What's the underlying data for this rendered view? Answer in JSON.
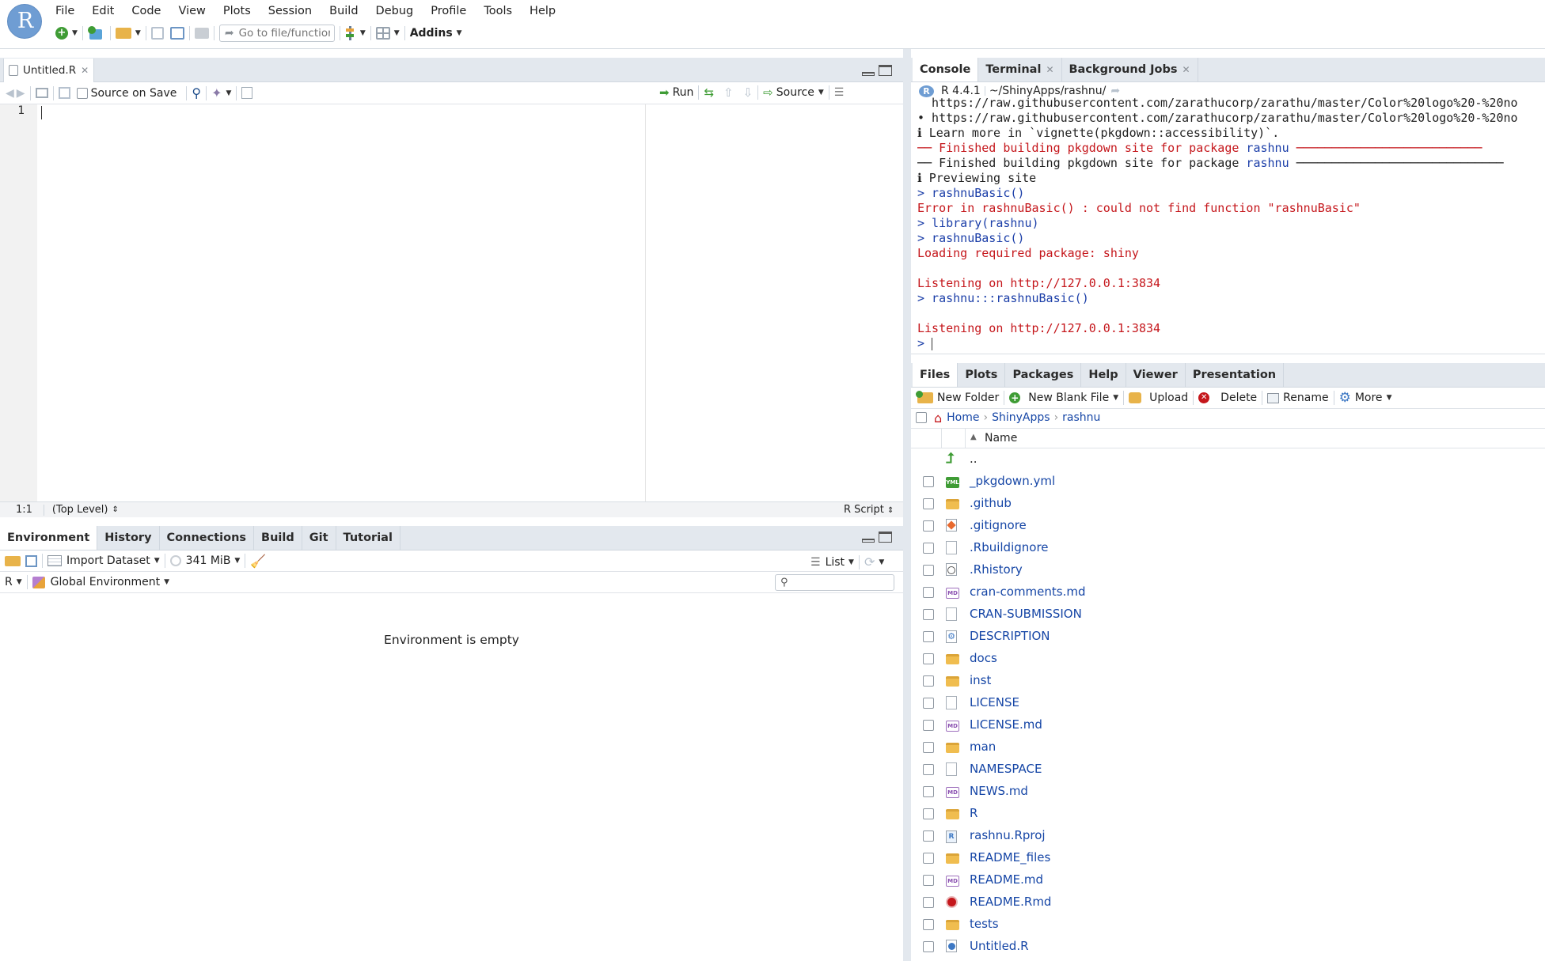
{
  "menu": [
    "File",
    "Edit",
    "Code",
    "View",
    "Plots",
    "Session",
    "Build",
    "Debug",
    "Profile",
    "Tools",
    "Help"
  ],
  "toolbar": {
    "goto_placeholder": "Go to file/function",
    "addins": "Addins"
  },
  "editor": {
    "tab_label": "Untitled.R",
    "source_on_save": "Source on Save",
    "run": "Run",
    "source": "Source",
    "line_number": "1",
    "status_pos": "1:1",
    "status_scope": "(Top Level)",
    "status_type": "R Script"
  },
  "env": {
    "tabs": [
      "Environment",
      "History",
      "Connections",
      "Build",
      "Git",
      "Tutorial"
    ],
    "import_dataset": "Import Dataset",
    "memory": "341 MiB",
    "list": "List",
    "lang": "R",
    "global_env": "Global Environment",
    "empty_msg": "Environment is empty"
  },
  "console": {
    "tabs": [
      "Console",
      "Terminal",
      "Background Jobs"
    ],
    "version": "R 4.4.1",
    "path": "~/ShinyApps/rashnu/",
    "lines": [
      {
        "t": "  https://raw.githubusercontent.com/zarathucorp/zarathu/master/Color%20logo%20-%20no",
        "c": "dk"
      },
      {
        "t": "• https://raw.githubusercontent.com/zarathucorp/zarathu/master/Color%20logo%20-%20no",
        "c": "dk"
      },
      {
        "t": "ℹ Learn more in `vignette(pkgdown::accessibility)`.",
        "c": "dk"
      },
      {
        "t": "── Finished building pkgdown site for package ",
        "c": "red",
        "b": "rashnu",
        "after": " ──────────────────────────",
        "ac": "red"
      },
      {
        "t": "── Finished building pkgdown site for package ",
        "c": "dk",
        "b": "rashnu",
        "after": " ─────────────────────────────",
        "ac": "dk"
      },
      {
        "t": "ℹ Previewing site",
        "c": "dk"
      },
      {
        "t": "> rashnuBasic()",
        "c": "blue"
      },
      {
        "t": "Error in rashnuBasic() : could not find function \"rashnuBasic\"",
        "c": "red"
      },
      {
        "t": "> library(rashnu)",
        "c": "blue"
      },
      {
        "t": "> rashnuBasic()",
        "c": "blue"
      },
      {
        "t": "Loading required package: shiny",
        "c": "red"
      },
      {
        "t": "",
        "c": "dk"
      },
      {
        "t": "Listening on http://127.0.0.1:3834",
        "c": "red"
      },
      {
        "t": "> rashnu:::rashnuBasic()",
        "c": "blue"
      },
      {
        "t": "",
        "c": "dk"
      },
      {
        "t": "Listening on http://127.0.0.1:3834",
        "c": "red"
      },
      {
        "t": "> ",
        "c": "blue"
      }
    ]
  },
  "files": {
    "tabs": [
      "Files",
      "Plots",
      "Packages",
      "Help",
      "Viewer",
      "Presentation"
    ],
    "new_folder": "New Folder",
    "new_blank_file": "New Blank File",
    "upload": "Upload",
    "delete": "Delete",
    "rename": "Rename",
    "more": "More",
    "breadcrumb": [
      "Home",
      "ShinyApps",
      "rashnu"
    ],
    "col_name": "Name",
    "up_label": "..",
    "items": [
      {
        "name": "_pkgdown.yml",
        "icon": "yml"
      },
      {
        "name": ".github",
        "icon": "folder"
      },
      {
        "name": ".gitignore",
        "icon": "git"
      },
      {
        "name": ".Rbuildignore",
        "icon": "file"
      },
      {
        "name": ".Rhistory",
        "icon": "history"
      },
      {
        "name": "cran-comments.md",
        "icon": "md"
      },
      {
        "name": "CRAN-SUBMISSION",
        "icon": "file"
      },
      {
        "name": "DESCRIPTION",
        "icon": "gear"
      },
      {
        "name": "docs",
        "icon": "folder"
      },
      {
        "name": "inst",
        "icon": "folder"
      },
      {
        "name": "LICENSE",
        "icon": "file"
      },
      {
        "name": "LICENSE.md",
        "icon": "md"
      },
      {
        "name": "man",
        "icon": "folder"
      },
      {
        "name": "NAMESPACE",
        "icon": "file"
      },
      {
        "name": "NEWS.md",
        "icon": "md"
      },
      {
        "name": "R",
        "icon": "folder"
      },
      {
        "name": "rashnu.Rproj",
        "icon": "rproj"
      },
      {
        "name": "README_files",
        "icon": "folder"
      },
      {
        "name": "README.md",
        "icon": "md"
      },
      {
        "name": "README.Rmd",
        "icon": "rmd"
      },
      {
        "name": "tests",
        "icon": "folder"
      },
      {
        "name": "Untitled.R",
        "icon": "rfile"
      }
    ]
  }
}
